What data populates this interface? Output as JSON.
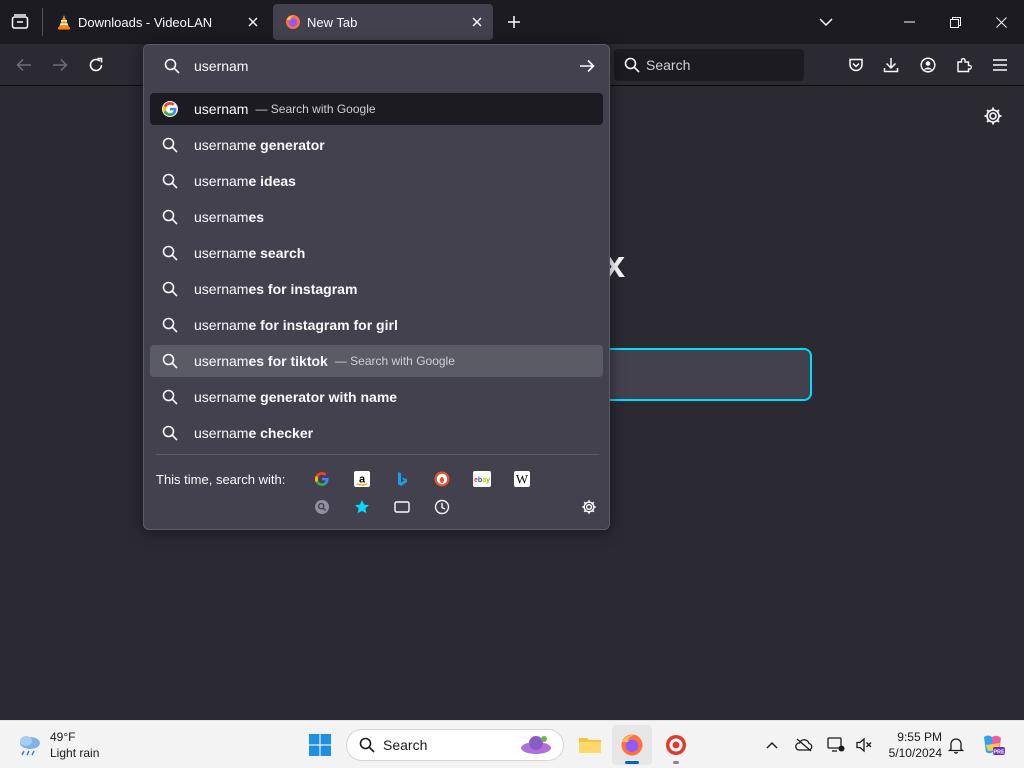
{
  "tabs": [
    {
      "label": "Downloads - VideoLAN",
      "active": false
    },
    {
      "label": "New Tab",
      "active": true
    }
  ],
  "toolbar": {
    "search_placeholder": "Search"
  },
  "urlbar": {
    "value": "usernam"
  },
  "suggestions": [
    {
      "typed": "usernam",
      "rest": "",
      "suffix": "— Search with Google",
      "icon": "google-icon",
      "state": "selected"
    },
    {
      "typed": "usernam",
      "rest": "e generator",
      "suffix": "",
      "icon": "search-icon",
      "state": ""
    },
    {
      "typed": "usernam",
      "rest": "e ideas",
      "suffix": "",
      "icon": "search-icon",
      "state": ""
    },
    {
      "typed": "usernam",
      "rest": "es",
      "suffix": "",
      "icon": "search-icon",
      "state": ""
    },
    {
      "typed": "usernam",
      "rest": "e search",
      "suffix": "",
      "icon": "search-icon",
      "state": ""
    },
    {
      "typed": "usernam",
      "rest": "es for instagram",
      "suffix": "",
      "icon": "search-icon",
      "state": ""
    },
    {
      "typed": "usernam",
      "rest": "e for instagram for girl",
      "suffix": "",
      "icon": "search-icon",
      "state": ""
    },
    {
      "typed": "usernam",
      "rest": "es for tiktok",
      "suffix": "— Search with Google",
      "icon": "search-icon",
      "state": "hover"
    },
    {
      "typed": "usernam",
      "rest": "e generator with name",
      "suffix": "",
      "icon": "search-icon",
      "state": ""
    },
    {
      "typed": "usernam",
      "rest": "e checker",
      "suffix": "",
      "icon": "search-icon",
      "state": ""
    }
  ],
  "one_off": {
    "label": "This time, search with:",
    "engines": [
      "google-icon",
      "amazon-icon",
      "bing-icon",
      "duckduckgo-icon",
      "ebay-icon",
      "wikipedia-icon"
    ],
    "modes": [
      "search-tabs-icon",
      "bookmarks-icon",
      "tabs-icon",
      "history-icon"
    ]
  },
  "newtab": {
    "logo_fragment": "x"
  },
  "taskbar": {
    "weather_temp": "49°F",
    "weather_desc": "Light rain",
    "search_label": "Search",
    "time": "9:55 PM",
    "date": "5/10/2024"
  },
  "colors": {
    "accent": "#00ddff",
    "popup_bg": "#42414d",
    "toolbar_bg": "#2b2a33",
    "titlebar_bg": "#1c1b22"
  }
}
